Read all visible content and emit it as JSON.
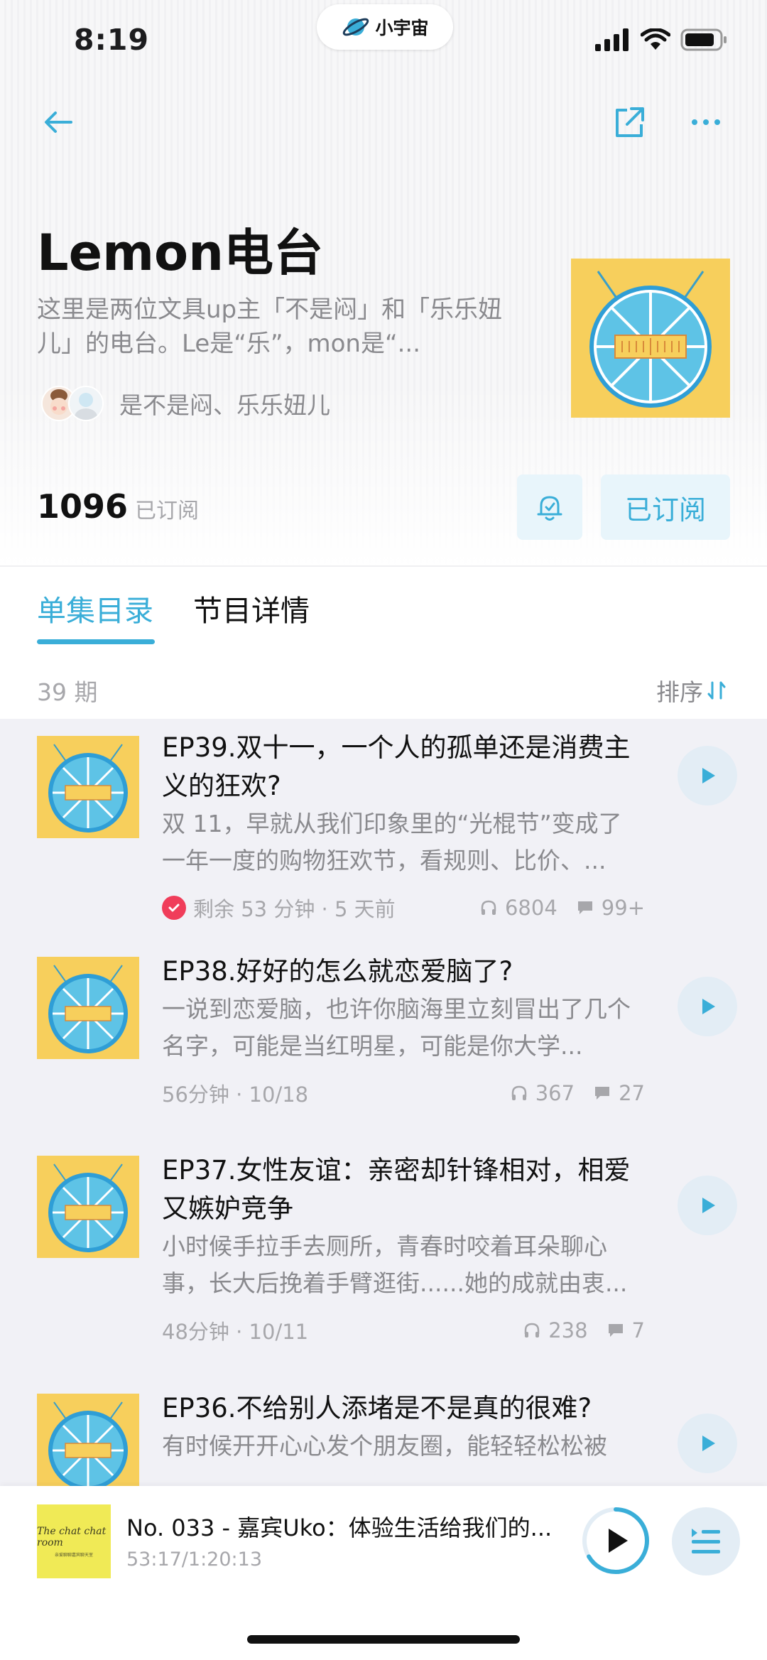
{
  "status_bar": {
    "time": "8:19",
    "island_label": "小宇宙"
  },
  "podcast": {
    "title": "Lemon电台",
    "description": "这里是两位文具up主「不是闷」和「乐乐妞儿」的电台。Le是“乐”，mon是“...",
    "hosts": "是不是闷、乐乐妞儿",
    "subscriber_count": "1096",
    "subscriber_label": "已订阅",
    "subscribe_button": "已订阅"
  },
  "tabs": {
    "episodes": "单集目录",
    "details": "节目详情"
  },
  "list_header": {
    "count": "39 期",
    "sort_label": "排序"
  },
  "episodes": [
    {
      "title": "EP39.双十一，一个人的孤单还是消费主义的狂欢?",
      "description": "双 11，早就从我们印象里的“光棍节”变成了一年一度的购物狂欢节，看规则、比价、...",
      "meta": "剩余 53 分钟 · 5 天前",
      "plays": "6804",
      "comments": "99+"
    },
    {
      "title": "EP38.好好的怎么就恋爱脑了?",
      "description": "一说到恋爱脑，也许你脑海里立刻冒出了几个名字，可能是当红明星，可能是你大学...",
      "meta": "56分钟 · 10/18",
      "plays": "367",
      "comments": "27"
    },
    {
      "title": "EP37.女性友谊：亲密却针锋相对，相爱又嫉妒竞争",
      "description": "小时候手拉手去厕所，青春时咬着耳朵聊心事，长大后挽着手臂逛街......她的成就由衷...",
      "meta": "48分钟 · 10/11",
      "plays": "238",
      "comments": "7"
    },
    {
      "title": "EP36.不给别人添堵是不是真的很难?",
      "description": "有时候开开心心发个朋友圈，能轻轻松松被"
    }
  ],
  "player": {
    "title": "No. 033 - 嘉宾Uko：体验生活给我们的...",
    "time": "53:17/1:20:13",
    "cover_text": "The chat chat room",
    "cover_subtext": "亲爱聊聊嘉宾聊天室",
    "progress_fraction": 0.664
  },
  "colors": {
    "accent": "#3aaed8",
    "cover_bg": "#f7cf5c",
    "list_bg": "#f1f1f6",
    "check_red": "#f03d5a"
  }
}
